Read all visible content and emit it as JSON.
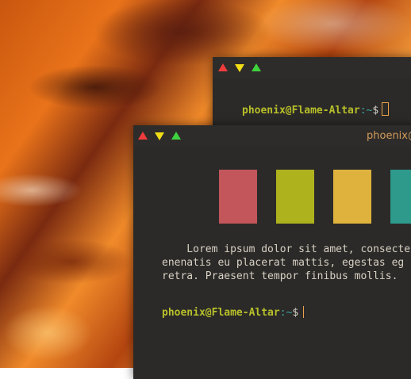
{
  "back_terminal": {
    "prompt_user": "phoenix@Flame-Altar",
    "prompt_path": ":~",
    "prompt_sign": "$"
  },
  "front_terminal": {
    "title": "phoenix@",
    "swatches": [
      "#c2565a",
      "#adb21d",
      "#deb23c",
      "#2d9a8c"
    ],
    "lorem_lines": [
      "    Lorem ipsum dolor sit amet, consecte",
      "enenatis eu placerat mattis, egestas eg",
      "retra. Praesent tempor finibus mollis."
    ],
    "prompt_user": "phoenix@Flame-Altar",
    "prompt_path": ":~",
    "prompt_sign": "$"
  }
}
